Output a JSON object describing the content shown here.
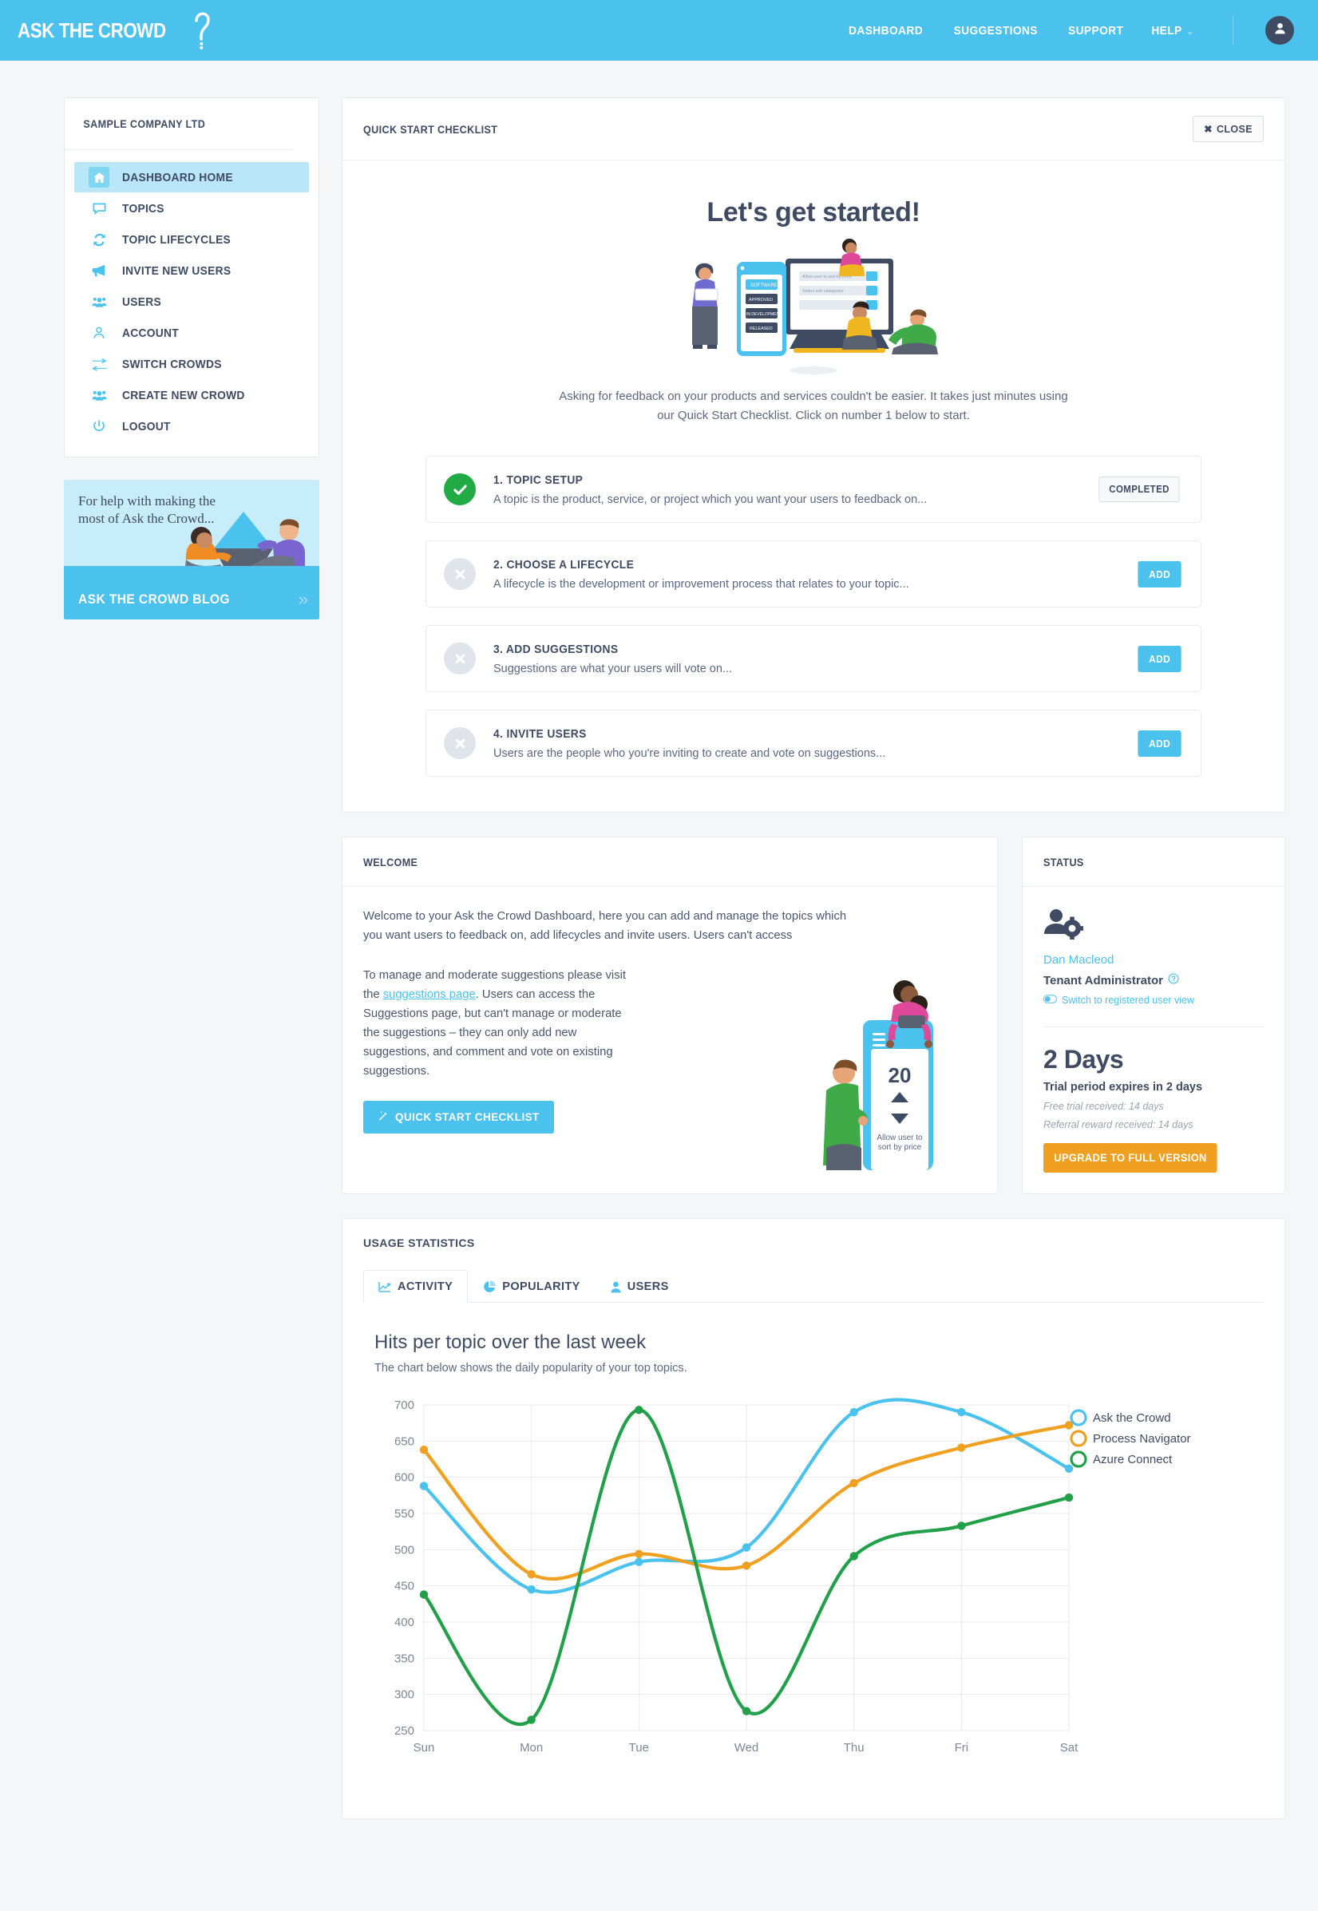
{
  "header": {
    "brand": "ASK THE CROWD",
    "nav": [
      {
        "label": "DASHBOARD",
        "name": "nav-dashboard"
      },
      {
        "label": "SUGGESTIONS",
        "name": "nav-suggestions"
      },
      {
        "label": "SUPPORT",
        "name": "nav-support"
      },
      {
        "label": "HELP",
        "name": "nav-help",
        "caret": "⌄"
      }
    ],
    "avatar_icon": "user-icon"
  },
  "sidebar": {
    "company": "SAMPLE COMPANY LTD",
    "items": [
      {
        "label": "DASHBOARD HOME",
        "icon": "home-icon",
        "active": true
      },
      {
        "label": "TOPICS",
        "icon": "comment-icon",
        "active": false
      },
      {
        "label": "TOPIC LIFECYCLES",
        "icon": "refresh-icon",
        "active": false
      },
      {
        "label": "INVITE NEW USERS",
        "icon": "megaphone-icon",
        "active": false
      },
      {
        "label": "USERS",
        "icon": "users-icon",
        "active": false
      },
      {
        "label": "ACCOUNT",
        "icon": "person-icon",
        "active": false
      },
      {
        "label": "SWITCH CROWDS",
        "icon": "exchange-icon",
        "active": false
      },
      {
        "label": "CREATE NEW CROWD",
        "icon": "users-plus-icon",
        "active": false
      },
      {
        "label": "LOGOUT",
        "icon": "power-icon",
        "active": false
      }
    ],
    "promo": {
      "text": "For help with making the most of Ask the Crowd...",
      "cta": "ASK THE CROWD BLOG",
      "chevron": "»"
    }
  },
  "checklist": {
    "panel_title": "QUICK START CHECKLIST",
    "close_label": "CLOSE",
    "close_icon": "x-icon",
    "heading": "Let's get started!",
    "subtext": "Asking for feedback on your products and services couldn't be easier. It takes just minutes using our Quick Start Checklist. Click on number 1 below to start.",
    "items": [
      {
        "title": "1. TOPIC SETUP",
        "desc": "A topic is the product, service, or project which you want your users to feedback on...",
        "state": "done",
        "action": "COMPLETED"
      },
      {
        "title": "2. CHOOSE A LIFECYCLE",
        "desc": "A lifecycle is the development or improvement process that relates to your topic...",
        "state": "todo",
        "action": "ADD"
      },
      {
        "title": "3. ADD SUGGESTIONS",
        "desc": "Suggestions are what your users will vote on...",
        "state": "todo",
        "action": "ADD"
      },
      {
        "title": "4. INVITE USERS",
        "desc": "Users are the people who you're inviting to create and vote on suggestions...",
        "state": "todo",
        "action": "ADD"
      }
    ]
  },
  "welcome": {
    "panel_title": "WELCOME",
    "paragraph1": "Welcome to your Ask the Crowd Dashboard, here you can add and manage the topics which you want users to feedback on, add lifecycles and invite users. Users can't access",
    "paragraph2_pre": "To manage and moderate suggestions please visit the ",
    "paragraph2_link": "suggestions page",
    "paragraph2_post": ". Users can access the Suggestions page, but can't manage or moderate the suggestions – they can only add new suggestions, and comment and vote on existing suggestions.",
    "button_label": "QUICK START CHECKLIST",
    "button_icon": "magic-wand-icon",
    "illustration": {
      "counter": "20",
      "caption_line1": "Allow user to",
      "caption_line2": "sort by price"
    }
  },
  "status": {
    "panel_title": "STATUS",
    "avatar_icon": "user-cog-icon",
    "user_name": "Dan Macleod",
    "role": "Tenant Administrator",
    "role_help_icon": "question-circle-icon",
    "switch_icon": "toggle-icon",
    "switch_label": "Switch to registered user view",
    "days": "2 Days",
    "trial_line": "Trial period expires in 2 days",
    "free_trial": "Free trial received: 14 days",
    "referral": "Referral reward received: 14 days",
    "upgrade_label": "UPGRADE TO FULL VERSION",
    "upgrade_color": "#f0a020"
  },
  "usage": {
    "panel_title": "USAGE STATISTICS",
    "tabs": [
      {
        "label": "ACTIVITY",
        "icon": "line-chart-icon",
        "active": true
      },
      {
        "label": "POPULARITY",
        "icon": "pie-chart-icon",
        "active": false
      },
      {
        "label": "USERS",
        "icon": "person-icon",
        "active": false
      }
    ]
  },
  "chart_data": {
    "type": "line",
    "title": "Hits per topic over the last week",
    "subtitle": "The chart below shows the daily popularity of your top topics.",
    "xlabel": "",
    "ylabel": "",
    "categories": [
      "Sun",
      "Mon",
      "Tue",
      "Wed",
      "Thu",
      "Fri",
      "Sat"
    ],
    "ylim": [
      250,
      700
    ],
    "yticks": [
      250,
      300,
      350,
      400,
      450,
      500,
      550,
      600,
      650,
      700
    ],
    "grid": true,
    "legend_position": "right",
    "curved": true,
    "series": [
      {
        "name": "Ask the Crowd",
        "color": "#4bc1ee",
        "values": [
          588,
          445,
          483,
          503,
          690,
          690,
          612
        ]
      },
      {
        "name": "Process Navigator",
        "color": "#f0a020",
        "values": [
          638,
          466,
          494,
          478,
          592,
          641,
          672
        ]
      },
      {
        "name": "Azure Connect",
        "color": "#22a049",
        "values": [
          438,
          265,
          693,
          277,
          491,
          533,
          572
        ]
      }
    ]
  }
}
